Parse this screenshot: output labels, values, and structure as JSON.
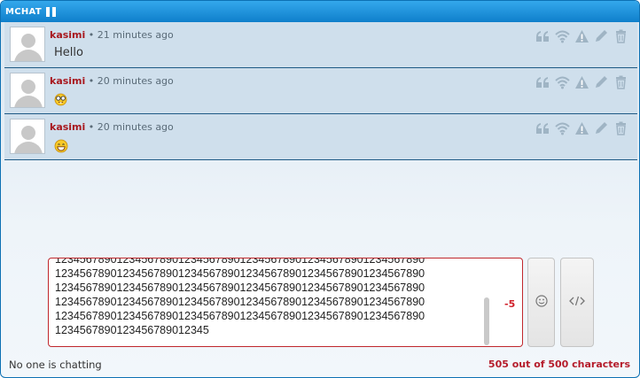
{
  "header": {
    "title": "MCHAT"
  },
  "messages": [
    {
      "username": "kasimi",
      "separator": "•",
      "time": "21 minutes ago",
      "text": "Hello",
      "emoji": ""
    },
    {
      "username": "kasimi",
      "separator": "•",
      "time": "20 minutes ago",
      "text": "",
      "emoji": "nerd-face"
    },
    {
      "username": "kasimi",
      "separator": "•",
      "time": "20 minutes ago",
      "text": "",
      "emoji": "grinning-face"
    }
  ],
  "message_actions": [
    "quote-icon",
    "wifi-icon",
    "warning-icon",
    "pencil-icon",
    "trash-icon"
  ],
  "input": {
    "value": "123456789012345678901234567890123456789012345678901234567890\n123456789012345678901234567890123456789012345678901234567890\n123456789012345678901234567890123456789012345678901234567890\n123456789012345678901234567890123456789012345678901234567890\n123456789012345678901234567890123456789012345678901234567890\n1234567890123456789012345",
    "remaining": "-5"
  },
  "footer": {
    "status": "No one is chatting",
    "char_count": "505 out of 500 characters"
  },
  "colors": {
    "header": "#1589d4",
    "username": "#a8181e",
    "error": "#d0202a",
    "icon": "#9fb4c4"
  }
}
